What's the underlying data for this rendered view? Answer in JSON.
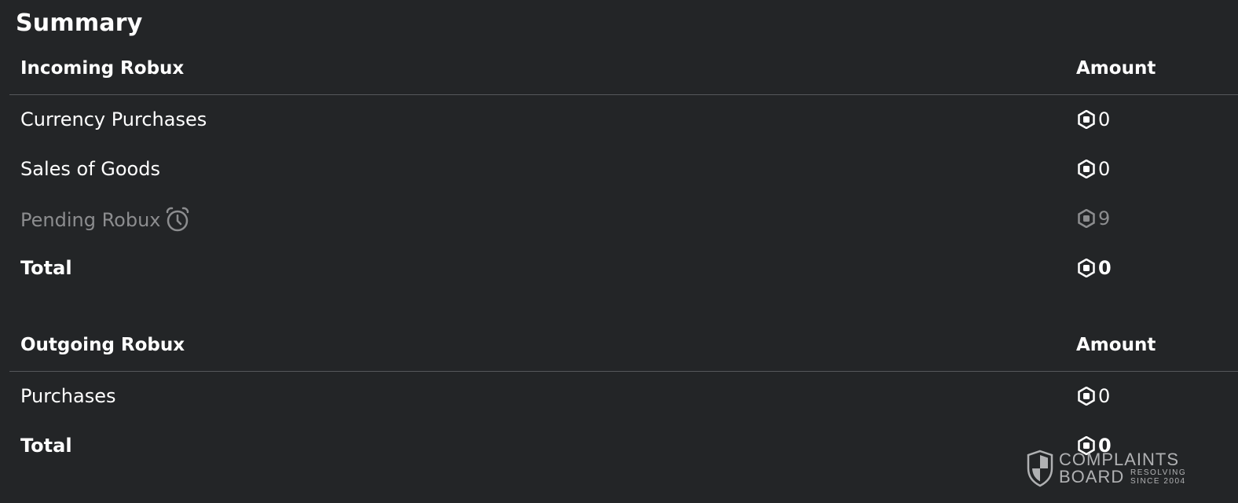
{
  "summary": {
    "title": "Summary"
  },
  "incoming": {
    "header_label": "Incoming Robux",
    "header_amount": "Amount",
    "rows": [
      {
        "label": "Currency Purchases",
        "amount": "0"
      },
      {
        "label": "Sales of Goods",
        "amount": "0"
      },
      {
        "label": "Pending Robux",
        "amount": "9",
        "icon": "clock-icon"
      },
      {
        "label": "Total",
        "amount": "0"
      }
    ]
  },
  "outgoing": {
    "header_label": "Outgoing Robux",
    "header_amount": "Amount",
    "rows": [
      {
        "label": "Purchases",
        "amount": "0"
      },
      {
        "label": "Total",
        "amount": "0"
      }
    ]
  },
  "watermark": {
    "line1": "COMPLAINTS",
    "line2": "BOARD",
    "tag1": "RESOLVING",
    "tag2": "SINCE 2004"
  },
  "colors": {
    "background": "#232527",
    "text": "#ffffff",
    "muted_text": "#8c8d8f",
    "divider": "#56585b"
  },
  "icons": {
    "currency": "robux-icon",
    "pending": "clock-icon",
    "watermark": "shield-icon"
  }
}
